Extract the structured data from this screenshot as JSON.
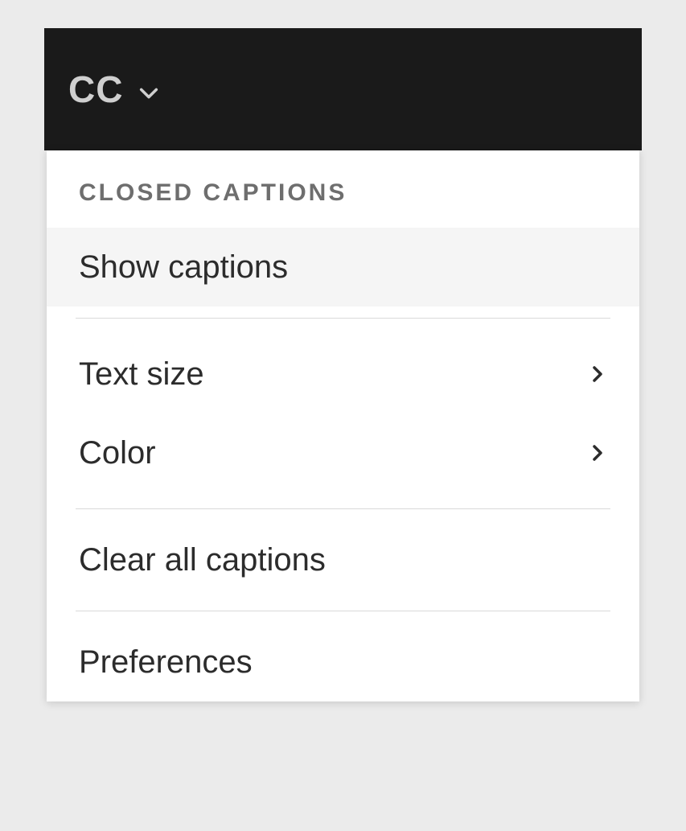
{
  "toolbar": {
    "cc_label": "CC"
  },
  "menu": {
    "header": "CLOSED CAPTIONS",
    "show_captions": "Show captions",
    "text_size": "Text size",
    "color": "Color",
    "clear_all": "Clear all captions",
    "preferences": "Preferences"
  }
}
